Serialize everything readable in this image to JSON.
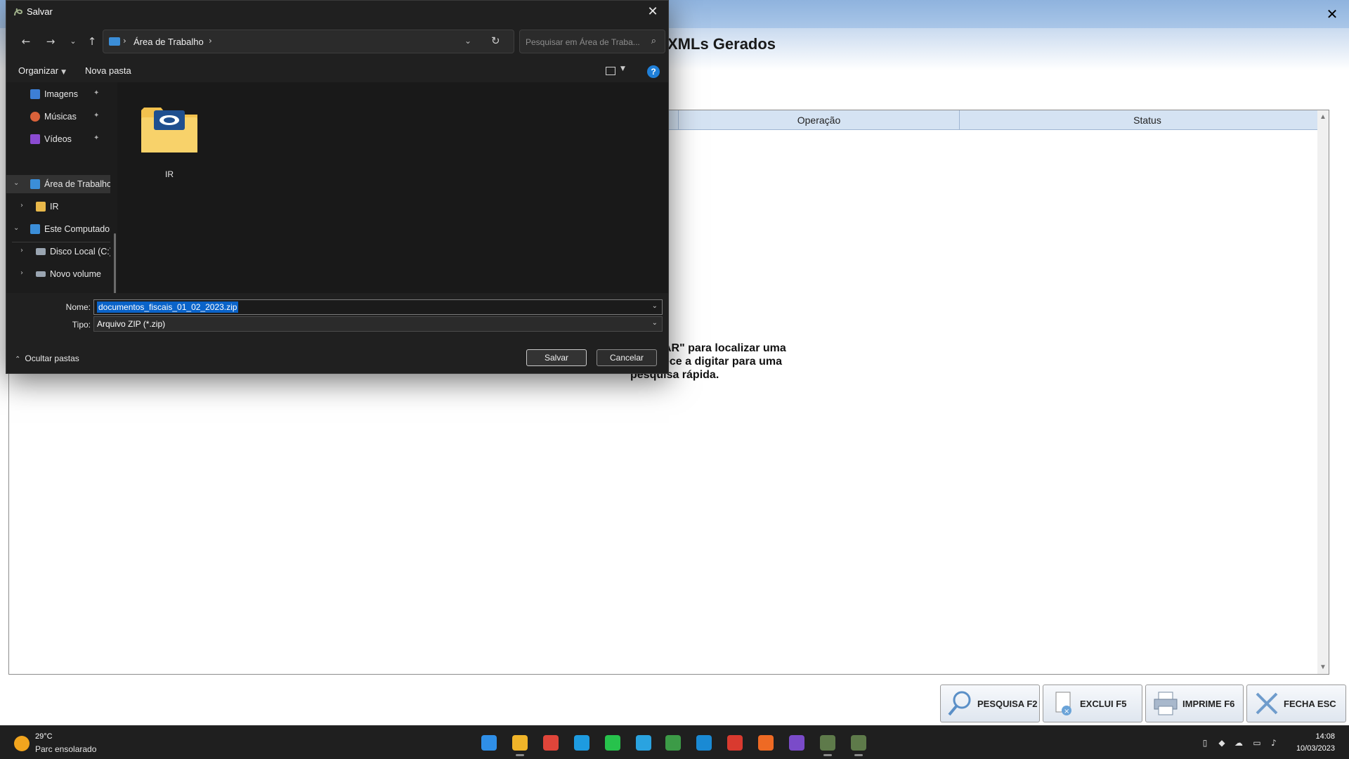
{
  "background_app": {
    "title": "XMLs Gerados",
    "close_glyph": "✕",
    "columns": [
      "Operação",
      "Status"
    ],
    "hint_line1": "AR\" para localizar uma",
    "hint_line2": "ece a digitar para uma",
    "hint_line3": "pesquisa rápida.",
    "function_keys": [
      {
        "label": "PESQUISA F2",
        "icon": "magnifier-icon"
      },
      {
        "label": "EXCLUI F5",
        "icon": "delete-document-icon"
      },
      {
        "label": "IMPRIME F6",
        "icon": "printer-icon"
      },
      {
        "label": "FECHA ESC",
        "icon": "close-x-icon"
      }
    ]
  },
  "dialog": {
    "title": "Salvar",
    "address": {
      "path": "Área de Trabalho",
      "separator": "›"
    },
    "search": {
      "placeholder": "Pesquisar em Área de Traba..."
    },
    "commands": {
      "organize": "Organizar",
      "new_folder": "Nova pasta"
    },
    "nav_items": [
      {
        "label": "Imagens",
        "icon": "pictures-icon",
        "color": "#3d7fd6",
        "pinned": true
      },
      {
        "label": "Músicas",
        "icon": "music-icon",
        "color": "#d9623a",
        "pinned": true
      },
      {
        "label": "Vídeos",
        "icon": "videos-icon",
        "color": "#8b4bd1",
        "pinned": true
      },
      {
        "label": "Área de Trabalho",
        "icon": "desktop-icon",
        "color": "#3b8ed8",
        "selected": true
      },
      {
        "label": "IR",
        "icon": "folder-icon",
        "color": "#e8b84a"
      },
      {
        "label": "Este Computador",
        "icon": "computer-icon",
        "color": "#3b8ed8"
      },
      {
        "label": "Disco Local (C:)",
        "icon": "drive-icon",
        "color": "#9aa5b1"
      },
      {
        "label": "Novo volume",
        "icon": "drive-icon",
        "color": "#9aa5b1"
      }
    ],
    "folder": {
      "label": "IR"
    },
    "filename_label": "Nome:",
    "filename_value": "documentos_fiscais_01_02_2023.zip",
    "filetype_label": "Tipo:",
    "filetype_value": "Arquivo ZIP (*.zip)",
    "hide_folders": "Ocultar pastas",
    "save_button": "Salvar",
    "cancel_button": "Cancelar"
  },
  "taskbar": {
    "weather_temp": "29°C",
    "weather_desc": "Parc ensolarado",
    "time": "14:08",
    "date": "10/03/2023",
    "apps": [
      {
        "name": "start-icon",
        "color": "#2f8fe8"
      },
      {
        "name": "file-explorer-icon",
        "color": "#f0b429"
      },
      {
        "name": "chrome-icon",
        "color": "#e0453a"
      },
      {
        "name": "edge-icon",
        "color": "#1e9be0"
      },
      {
        "name": "whatsapp-icon",
        "color": "#27c24c"
      },
      {
        "name": "telegram-icon",
        "color": "#2aa3e0"
      },
      {
        "name": "spreadsheet-icon",
        "color": "#3c9b47"
      },
      {
        "name": "remote-app-icon",
        "color": "#1a8ad4"
      },
      {
        "name": "red-app-icon",
        "color": "#d93a2f"
      },
      {
        "name": "firefox-icon",
        "color": "#ee6a24"
      },
      {
        "name": "media-app-icon",
        "color": "#7a4bc9"
      },
      {
        "name": "system-app-icon",
        "color": "#5e7a4a"
      },
      {
        "name": "system-app-2-icon",
        "color": "#5e7a4a"
      }
    ]
  }
}
